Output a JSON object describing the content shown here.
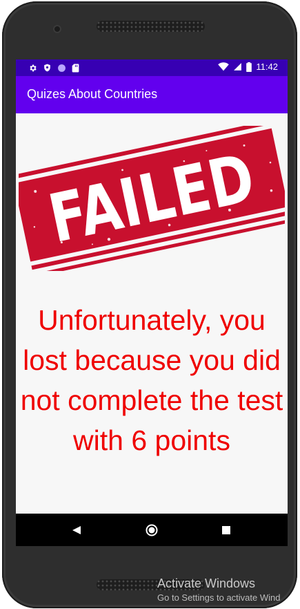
{
  "status_bar": {
    "time": "11:42",
    "left_icons": [
      "settings-icon",
      "shield-icon",
      "circle-icon",
      "sd-card-icon"
    ],
    "right_icons": [
      "wifi-icon",
      "signal-icon",
      "battery-icon"
    ]
  },
  "app_bar": {
    "title": "Quizes About Countries"
  },
  "content": {
    "stamp_text": "FAILED",
    "message": "Unfortunately, you lost because you did not complete the test with 6 points"
  },
  "nav_bar": {
    "buttons": [
      "back-icon",
      "home-icon",
      "recents-icon"
    ]
  },
  "watermark": {
    "title": "Activate Windows",
    "subtitle": "Go to Settings to activate Wind"
  },
  "colors": {
    "status_bar": "#3700b3",
    "app_bar": "#6200ee",
    "message_text": "#ef0000",
    "stamp_red": "#c8102e"
  }
}
